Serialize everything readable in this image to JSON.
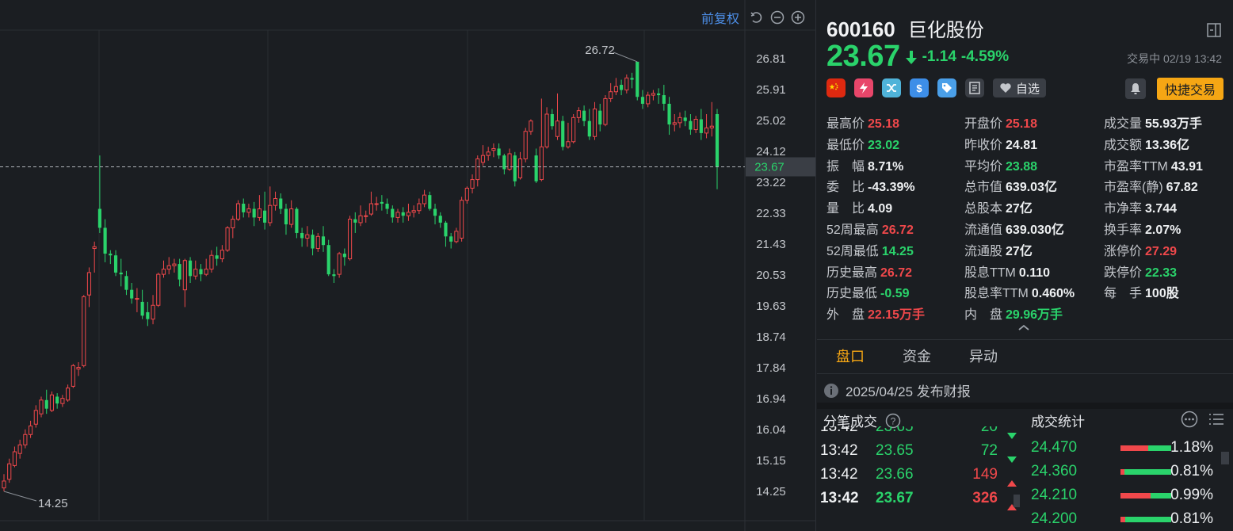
{
  "chart": {
    "adjust_label": "前复权",
    "y_ticks": [
      "26.81",
      "25.91",
      "25.02",
      "24.12",
      "23.22",
      "22.33",
      "21.43",
      "20.53",
      "19.63",
      "18.74",
      "17.84",
      "16.94",
      "16.04",
      "15.15",
      "14.25"
    ],
    "high_label": "26.72",
    "low_label": "14.25",
    "last_price_label": "23.67",
    "colors": {
      "up": "#f0484b",
      "down": "#2ad36b",
      "grid": "#2a2e33",
      "axis_text": "#c4c7cc",
      "last": "#2ad36b"
    }
  },
  "chart_data": {
    "type": "candlestick",
    "y_range": [
      14.25,
      26.81
    ],
    "candles": [
      [
        14.35,
        14.55,
        14.25,
        14.75
      ],
      [
        14.6,
        15.05,
        14.5,
        15.2
      ],
      [
        15.0,
        15.4,
        14.95,
        15.55
      ],
      [
        15.35,
        15.6,
        15.2,
        15.75
      ],
      [
        15.6,
        15.9,
        15.5,
        16.05
      ],
      [
        15.9,
        16.15,
        15.8,
        16.3
      ],
      [
        16.2,
        16.6,
        16.1,
        16.75
      ],
      [
        16.5,
        16.9,
        16.4,
        17.0
      ],
      [
        16.9,
        16.65,
        16.5,
        17.2
      ],
      [
        16.6,
        17.05,
        16.55,
        17.15
      ],
      [
        17.0,
        16.8,
        16.65,
        17.1
      ],
      [
        16.8,
        16.95,
        16.7,
        17.05
      ],
      [
        16.9,
        17.25,
        16.85,
        17.35
      ],
      [
        17.3,
        17.9,
        17.25,
        17.95
      ],
      [
        17.8,
        17.85,
        17.6,
        18.0
      ],
      [
        17.9,
        19.9,
        17.85,
        19.95
      ],
      [
        19.95,
        20.6,
        19.6,
        20.75
      ],
      [
        21.3,
        21.35,
        20.6,
        21.5
      ],
      [
        22.45,
        21.9,
        21.75,
        24.0
      ],
      [
        21.9,
        21.15,
        20.9,
        22.15
      ],
      [
        21.15,
        21.1,
        20.85,
        21.25
      ],
      [
        21.1,
        20.6,
        20.5,
        21.25
      ],
      [
        20.6,
        20.55,
        20.2,
        21.0
      ],
      [
        20.5,
        20.1,
        19.95,
        20.65
      ],
      [
        20.1,
        19.85,
        19.7,
        20.3
      ],
      [
        19.85,
        19.85,
        19.45,
        20.15
      ],
      [
        19.75,
        19.35,
        19.25,
        20.1
      ],
      [
        19.45,
        19.25,
        19.05,
        19.75
      ],
      [
        19.25,
        19.65,
        19.1,
        19.95
      ],
      [
        19.65,
        20.55,
        19.6,
        20.6
      ],
      [
        20.55,
        20.7,
        20.45,
        20.95
      ],
      [
        20.7,
        20.8,
        20.55,
        21.05
      ],
      [
        20.8,
        20.85,
        20.6,
        21.0
      ],
      [
        20.85,
        20.4,
        20.2,
        21.0
      ],
      [
        20.1,
        20.95,
        19.6,
        21.0
      ],
      [
        20.95,
        20.5,
        20.3,
        21.05
      ],
      [
        20.5,
        20.7,
        20.4,
        20.95
      ],
      [
        20.7,
        20.55,
        20.35,
        20.85
      ],
      [
        20.55,
        20.7,
        20.5,
        21.0
      ],
      [
        20.7,
        21.1,
        20.6,
        21.25
      ],
      [
        21.1,
        21.0,
        20.8,
        21.35
      ],
      [
        21.0,
        21.25,
        20.9,
        21.4
      ],
      [
        21.25,
        21.9,
        21.2,
        21.95
      ],
      [
        21.9,
        22.15,
        21.6,
        22.25
      ],
      [
        22.15,
        22.6,
        22.1,
        22.7
      ],
      [
        22.6,
        22.35,
        22.2,
        22.75
      ],
      [
        22.35,
        22.45,
        22.2,
        22.6
      ],
      [
        22.45,
        22.2,
        21.95,
        22.65
      ],
      [
        22.2,
        22.45,
        22.1,
        22.85
      ],
      [
        22.4,
        22.05,
        21.85,
        22.95
      ],
      [
        22.05,
        22.55,
        21.95,
        23.1
      ],
      [
        22.55,
        22.75,
        22.4,
        22.95
      ],
      [
        22.75,
        22.45,
        22.3,
        22.9
      ],
      [
        22.45,
        22.0,
        21.7,
        22.6
      ],
      [
        22.0,
        22.45,
        21.9,
        22.7
      ],
      [
        22.45,
        21.75,
        21.6,
        22.5
      ],
      [
        21.75,
        21.6,
        21.35,
        21.9
      ],
      [
        21.6,
        21.7,
        21.35,
        21.95
      ],
      [
        21.7,
        21.3,
        21.1,
        21.85
      ],
      [
        21.3,
        21.65,
        21.2,
        21.75
      ],
      [
        21.65,
        21.4,
        21.2,
        21.95
      ],
      [
        21.4,
        20.55,
        20.5,
        21.55
      ],
      [
        20.55,
        20.5,
        20.3,
        20.7
      ],
      [
        20.55,
        21.15,
        20.45,
        21.2
      ],
      [
        21.15,
        21.05,
        20.8,
        21.3
      ],
      [
        21.0,
        22.15,
        20.95,
        22.25
      ],
      [
        22.15,
        22.05,
        21.75,
        22.35
      ],
      [
        22.05,
        22.25,
        21.95,
        22.55
      ],
      [
        22.25,
        22.25,
        22.05,
        22.4
      ],
      [
        22.3,
        22.6,
        22.25,
        22.95
      ],
      [
        22.6,
        22.6,
        22.4,
        22.8
      ],
      [
        22.65,
        22.6,
        22.4,
        22.85
      ],
      [
        22.6,
        22.45,
        22.3,
        22.75
      ],
      [
        22.45,
        22.2,
        22.05,
        22.55
      ],
      [
        22.2,
        22.35,
        22.05,
        22.45
      ],
      [
        22.35,
        22.25,
        22.05,
        22.5
      ],
      [
        22.25,
        22.35,
        22.1,
        22.6
      ],
      [
        22.35,
        22.4,
        22.2,
        22.55
      ],
      [
        22.4,
        22.6,
        22.3,
        22.75
      ],
      [
        22.6,
        22.85,
        22.5,
        23.0
      ],
      [
        22.85,
        22.45,
        22.4,
        22.95
      ],
      [
        22.45,
        22.25,
        22.0,
        22.6
      ],
      [
        22.25,
        22.05,
        21.9,
        22.35
      ],
      [
        22.05,
        21.65,
        21.35,
        22.1
      ],
      [
        21.65,
        21.5,
        21.3,
        21.75
      ],
      [
        21.5,
        21.8,
        21.45,
        21.9
      ],
      [
        21.6,
        22.7,
        21.5,
        22.8
      ],
      [
        22.7,
        23.05,
        22.6,
        23.1
      ],
      [
        23.05,
        23.3,
        22.9,
        23.45
      ],
      [
        23.3,
        23.9,
        23.1,
        24.0
      ],
      [
        23.8,
        24.0,
        23.7,
        24.3
      ],
      [
        24.0,
        24.1,
        23.85,
        24.25
      ],
      [
        24.15,
        24.2,
        23.95,
        24.35
      ],
      [
        24.2,
        24.0,
        23.9,
        24.35
      ],
      [
        24.0,
        23.6,
        23.45,
        24.05
      ],
      [
        23.6,
        24.05,
        23.55,
        24.2
      ],
      [
        24.0,
        23.25,
        23.1,
        24.1
      ],
      [
        23.35,
        23.9,
        23.3,
        24.1
      ],
      [
        23.9,
        24.7,
        23.8,
        24.8
      ],
      [
        24.7,
        25.0,
        24.6,
        25.05
      ],
      [
        24.0,
        23.25,
        23.2,
        24.2
      ],
      [
        23.3,
        24.25,
        23.25,
        25.65
      ],
      [
        24.25,
        25.2,
        24.2,
        25.4
      ],
      [
        25.2,
        24.85,
        24.75,
        25.35
      ],
      [
        24.55,
        25.0,
        24.45,
        25.8
      ],
      [
        25.0,
        24.25,
        24.15,
        25.15
      ],
      [
        24.25,
        24.4,
        24.2,
        24.95
      ],
      [
        24.4,
        25.1,
        24.35,
        25.2
      ],
      [
        25.1,
        25.3,
        24.95,
        25.4
      ],
      [
        25.3,
        25.0,
        24.85,
        25.45
      ],
      [
        25.0,
        24.55,
        24.45,
        25.35
      ],
      [
        24.55,
        25.35,
        24.45,
        25.55
      ],
      [
        25.3,
        24.9,
        24.7,
        25.5
      ],
      [
        24.9,
        25.65,
        24.85,
        25.75
      ],
      [
        25.65,
        25.85,
        25.55,
        26.1
      ],
      [
        25.85,
        26.0,
        25.75,
        26.25
      ],
      [
        26.05,
        25.9,
        25.75,
        26.2
      ],
      [
        25.9,
        26.25,
        25.8,
        26.35
      ],
      [
        26.25,
        26.2,
        25.95,
        26.4
      ],
      [
        26.72,
        25.7,
        25.6,
        26.72
      ],
      [
        25.7,
        25.5,
        25.35,
        25.9
      ],
      [
        25.5,
        25.75,
        25.4,
        25.85
      ],
      [
        25.75,
        25.8,
        25.6,
        25.9
      ],
      [
        25.8,
        25.75,
        25.5,
        25.95
      ],
      [
        25.75,
        25.5,
        25.3,
        26.05
      ],
      [
        25.5,
        24.9,
        24.6,
        25.7
      ],
      [
        24.9,
        24.95,
        24.7,
        25.2
      ],
      [
        24.95,
        25.1,
        24.8,
        25.25
      ],
      [
        25.1,
        25.0,
        24.85,
        25.3
      ],
      [
        25.0,
        24.75,
        24.6,
        25.2
      ],
      [
        24.75,
        25.05,
        24.65,
        25.15
      ],
      [
        25.05,
        24.65,
        24.45,
        25.35
      ],
      [
        24.65,
        24.8,
        24.5,
        25.2
      ],
      [
        24.8,
        24.85,
        24.55,
        25.55
      ],
      [
        25.2,
        23.67,
        23.02,
        25.35
      ]
    ]
  },
  "quote": {
    "code": "600160",
    "name": "巨化股份",
    "price": "23.67",
    "change": "-1.14",
    "change_pct": "-4.59%",
    "status": "交易中 02/19 13:42",
    "watch_label": "自选",
    "trade_label": "快捷交易",
    "stats": [
      {
        "k": "最高价",
        "v": "25.18",
        "c": "red"
      },
      {
        "k": "开盘价",
        "v": "25.18",
        "c": "red"
      },
      {
        "k": "成交量",
        "v": "55.93万手",
        "c": "white"
      },
      {
        "k": "最低价",
        "v": "23.02",
        "c": "green"
      },
      {
        "k": "昨收价",
        "v": "24.81",
        "c": "white"
      },
      {
        "k": "成交额",
        "v": "13.36亿",
        "c": "white"
      },
      {
        "k": "振　幅",
        "v": "8.71%",
        "c": "white"
      },
      {
        "k": "平均价",
        "v": "23.88",
        "c": "green"
      },
      {
        "k": "市盈率TTM",
        "v": "43.91",
        "c": "white"
      },
      {
        "k": "委　比",
        "v": "-43.39%",
        "c": "white"
      },
      {
        "k": "总市值",
        "v": "639.03亿",
        "c": "white"
      },
      {
        "k": "市盈率(静)",
        "v": "67.82",
        "c": "white"
      },
      {
        "k": "量　比",
        "v": "4.09",
        "c": "white"
      },
      {
        "k": "总股本",
        "v": "27亿",
        "c": "white"
      },
      {
        "k": "市净率",
        "v": "3.744",
        "c": "white"
      },
      {
        "k": "52周最高",
        "v": "26.72",
        "c": "red"
      },
      {
        "k": "流通值",
        "v": "639.030亿",
        "c": "white"
      },
      {
        "k": "换手率",
        "v": "2.07%",
        "c": "white"
      },
      {
        "k": "52周最低",
        "v": "14.25",
        "c": "green"
      },
      {
        "k": "流通股",
        "v": "27亿",
        "c": "white"
      },
      {
        "k": "涨停价",
        "v": "27.29",
        "c": "red"
      },
      {
        "k": "历史最高",
        "v": "26.72",
        "c": "red"
      },
      {
        "k": "股息TTM",
        "v": "0.110",
        "c": "white"
      },
      {
        "k": "跌停价",
        "v": "22.33",
        "c": "green"
      },
      {
        "k": "历史最低",
        "v": "-0.59",
        "c": "green"
      },
      {
        "k": "股息率TTM",
        "v": "0.460%",
        "c": "white"
      },
      {
        "k": "每　手",
        "v": "100股",
        "c": "white"
      },
      {
        "k": "外　盘",
        "v": "22.15万手",
        "c": "red"
      },
      {
        "k": "内　盘",
        "v": "29.96万手",
        "c": "green"
      }
    ]
  },
  "tabs": [
    "盘口",
    "资金",
    "异动"
  ],
  "notice": "2025/04/25  发布财报",
  "ticks_title": "分笔成交",
  "stats_title": "成交统计",
  "ticks": [
    {
      "time": "13:42",
      "price": "23.65",
      "vol": "20",
      "dir": "down"
    },
    {
      "time": "13:42",
      "price": "23.65",
      "vol": "72",
      "dir": "down"
    },
    {
      "time": "13:42",
      "price": "23.66",
      "vol": "149",
      "dir": "up"
    },
    {
      "time": "13:42",
      "price": "23.67",
      "vol": "326",
      "dir": "up"
    }
  ],
  "volume_stats": [
    {
      "price": "24.470",
      "pct": "1.18%",
      "red": 0.55,
      "green": 0.45
    },
    {
      "price": "24.360",
      "pct": "0.81%",
      "red": 0.08,
      "green": 0.92
    },
    {
      "price": "24.210",
      "pct": "0.99%",
      "red": 0.6,
      "green": 0.4
    },
    {
      "price": "24.200",
      "pct": "0.81%",
      "red": 0.1,
      "green": 0.9
    }
  ]
}
